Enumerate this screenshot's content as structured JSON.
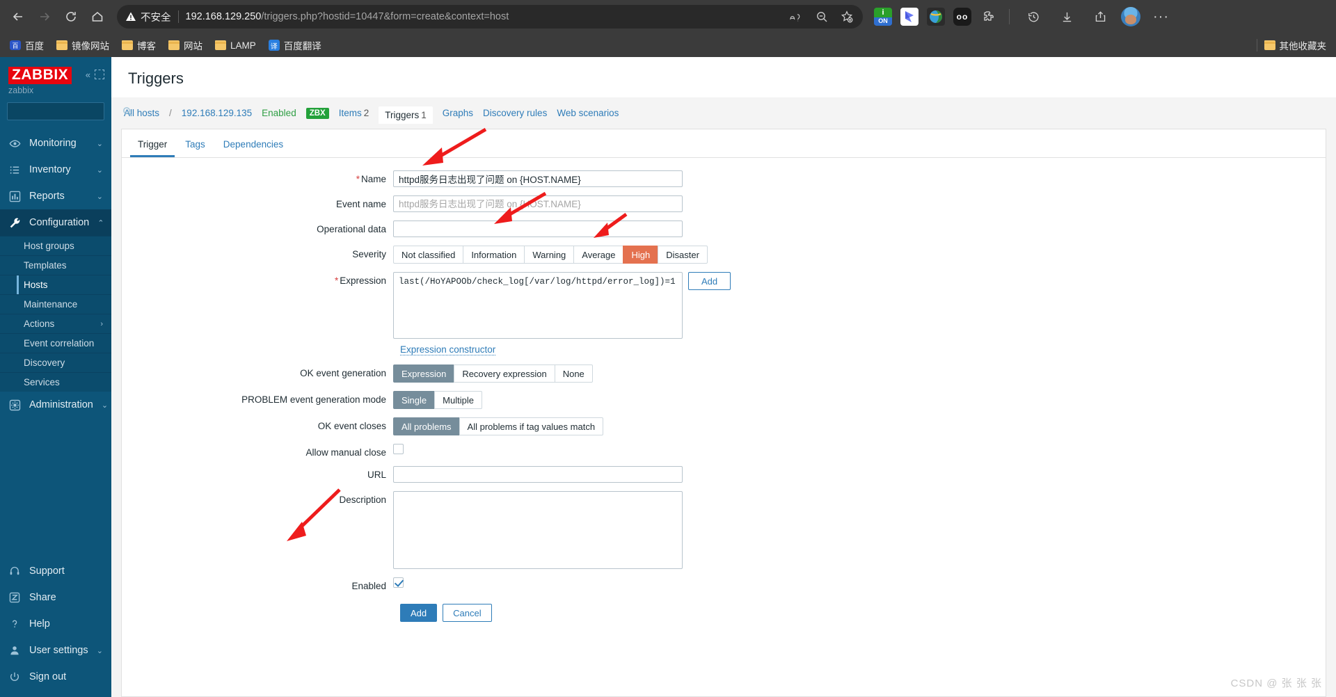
{
  "browser": {
    "nav": {
      "back": "back-arrow",
      "forward": "forward-arrow",
      "reload": "reload",
      "home": "home"
    },
    "omnibox": {
      "insecure_label": "不安全",
      "url_host": "192.168.129.250",
      "url_rest": "/triggers.php?hostid=10447&form=create&context=host",
      "actions": [
        "read-aloud",
        "zoom-out",
        "add-favorite"
      ]
    },
    "extensions": [
      "adguard-on",
      "bird-extension",
      "globe-extension",
      "oo-extension",
      "puzzle-extension"
    ],
    "right_actions": [
      "history",
      "downloads",
      "share",
      "profile",
      "more"
    ],
    "bookmarks": [
      {
        "label": "百度",
        "icon": "baidu-icon"
      },
      {
        "label": "镜像网站",
        "icon": "folder-icon"
      },
      {
        "label": "博客",
        "icon": "folder-icon"
      },
      {
        "label": "网站",
        "icon": "folder-icon"
      },
      {
        "label": "LAMP",
        "icon": "folder-icon"
      },
      {
        "label": "百度翻译",
        "icon": "translate-icon"
      }
    ],
    "other_bookmarks": "其他收藏夹"
  },
  "sidebar": {
    "logo": "ZABBIX",
    "user": "zabbix",
    "search_placeholder": "",
    "search_value": "",
    "items": [
      {
        "label": "Monitoring",
        "icon": "eye-icon",
        "chevron": "⌄"
      },
      {
        "label": "Inventory",
        "icon": "list-icon",
        "chevron": "⌄"
      },
      {
        "label": "Reports",
        "icon": "chart-icon",
        "chevron": "⌄"
      },
      {
        "label": "Configuration",
        "icon": "wrench-icon",
        "chevron": "⌃"
      }
    ],
    "config_sub": [
      {
        "label": "Host groups",
        "chevron": ""
      },
      {
        "label": "Templates",
        "chevron": ""
      },
      {
        "label": "Hosts",
        "chevron": ""
      },
      {
        "label": "Maintenance",
        "chevron": ""
      },
      {
        "label": "Actions",
        "chevron": "›"
      },
      {
        "label": "Event correlation",
        "chevron": ""
      },
      {
        "label": "Discovery",
        "chevron": ""
      },
      {
        "label": "Services",
        "chevron": ""
      }
    ],
    "administration": {
      "label": "Administration",
      "icon": "gear-icon",
      "chevron": "⌄"
    },
    "bottom": [
      {
        "label": "Support",
        "icon": "headset-icon",
        "chevron": ""
      },
      {
        "label": "Share",
        "icon": "zabbix-share-icon",
        "chevron": ""
      },
      {
        "label": "Help",
        "icon": "question-icon",
        "chevron": ""
      },
      {
        "label": "User settings",
        "icon": "user-icon",
        "chevron": "⌄"
      },
      {
        "label": "Sign out",
        "icon": "power-icon",
        "chevron": ""
      }
    ]
  },
  "page": {
    "title": "Triggers",
    "breadcrumb": {
      "all_hosts": "All hosts",
      "separator": "/",
      "host": "192.168.129.135",
      "status": "Enabled",
      "agent_badge": "ZBX",
      "links": [
        {
          "label": "Items",
          "count": "2",
          "selected": false
        },
        {
          "label": "Triggers",
          "count": "1",
          "selected": true
        },
        {
          "label": "Graphs",
          "count": "",
          "selected": false
        },
        {
          "label": "Discovery rules",
          "count": "",
          "selected": false
        },
        {
          "label": "Web scenarios",
          "count": "",
          "selected": false
        }
      ]
    },
    "tabs": [
      {
        "label": "Trigger",
        "active": true
      },
      {
        "label": "Tags",
        "active": false
      },
      {
        "label": "Dependencies",
        "active": false
      }
    ]
  },
  "form": {
    "name": {
      "label": "Name",
      "required": true,
      "value": "httpd服务日志出现了问题 on {HOST.NAME}"
    },
    "event_name": {
      "label": "Event name",
      "required": false,
      "value": "",
      "placeholder": "httpd服务日志出现了问题 on {HOST.NAME}"
    },
    "operational_data": {
      "label": "Operational data",
      "required": false,
      "value": "",
      "placeholder": ""
    },
    "severity": {
      "label": "Severity",
      "options": [
        "Not classified",
        "Information",
        "Warning",
        "Average",
        "High",
        "Disaster"
      ],
      "selected": "High"
    },
    "expression": {
      "label": "Expression",
      "required": true,
      "value": "last(/HoYAPOOb/check_log[/var/log/httpd/error_log])=1",
      "add_button": "Add",
      "constructor_link": "Expression constructor"
    },
    "ok_event_generation": {
      "label": "OK event generation",
      "options": [
        "Expression",
        "Recovery expression",
        "None"
      ],
      "selected": "Expression"
    },
    "problem_event_generation_mode": {
      "label": "PROBLEM event generation mode",
      "options": [
        "Single",
        "Multiple"
      ],
      "selected": "Single"
    },
    "ok_event_closes": {
      "label": "OK event closes",
      "options": [
        "All problems",
        "All problems if tag values match"
      ],
      "selected": "All problems"
    },
    "allow_manual_close": {
      "label": "Allow manual close",
      "checked": false
    },
    "url": {
      "label": "URL",
      "value": "",
      "placeholder": ""
    },
    "description": {
      "label": "Description",
      "value": "",
      "placeholder": ""
    },
    "enabled": {
      "label": "Enabled",
      "checked": true
    },
    "submit": "Add",
    "cancel": "Cancel"
  },
  "watermark": "CSDN @ 张 张 张",
  "colors": {
    "zabbix_red": "#e8050e",
    "sidebar_blue": "#0d5579",
    "accent_blue": "#2e7cb8",
    "severity_high": "#e4714f",
    "segment_gray": "#768d9b",
    "enabled_green": "#2f9e44",
    "arrow_red": "#ee1c1c"
  }
}
